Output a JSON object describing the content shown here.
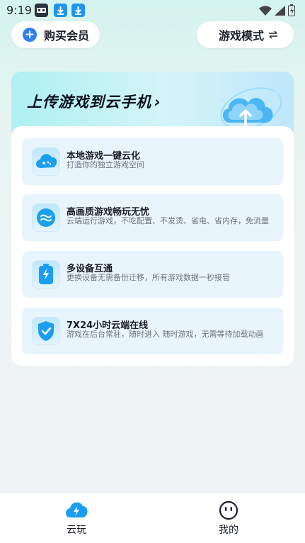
{
  "status_bar": {
    "time": "9:19",
    "icons": [
      "app-icon",
      "download-icon",
      "download-icon",
      "wifi-icon",
      "signal-icon",
      "battery-icon"
    ]
  },
  "header": {
    "buy_member": "购买会员",
    "game_mode": "游戏模式",
    "game_mode_icon": "swap-arrows-icon"
  },
  "banner": {
    "title": "上传游戏到云手机",
    "chevron": "›"
  },
  "features": [
    {
      "title": "本地游戏一键云化",
      "subtitle": "打造你的独立游戏空间",
      "icon": "cloud-gamepad-icon"
    },
    {
      "title": "高画质游戏畅玩无忧",
      "subtitle": "云端运行游戏，不吃配置、不发烫、省电、省内存，免流量",
      "icon": "waves-icon"
    },
    {
      "title": "多设备互通",
      "subtitle": "更换设备无需备份迁移，所有游戏数据一秒接管",
      "icon": "battery-bolt-icon"
    },
    {
      "title": "7X24小时云端在线",
      "subtitle": "游戏在后台常驻，随时进入 随时游戏，无需等待加载动画",
      "icon": "shield-check-icon"
    }
  ],
  "bottom_nav": {
    "items": [
      {
        "label": "云玩",
        "icon": "cloud-bolt-icon",
        "active": true
      },
      {
        "label": "我的",
        "icon": "smiley-icon",
        "active": false
      }
    ]
  },
  "colors": {
    "accent": "#2f7ff0",
    "icon_blue": "#1a9ff0",
    "feature_bg": "#e9f5fd"
  }
}
